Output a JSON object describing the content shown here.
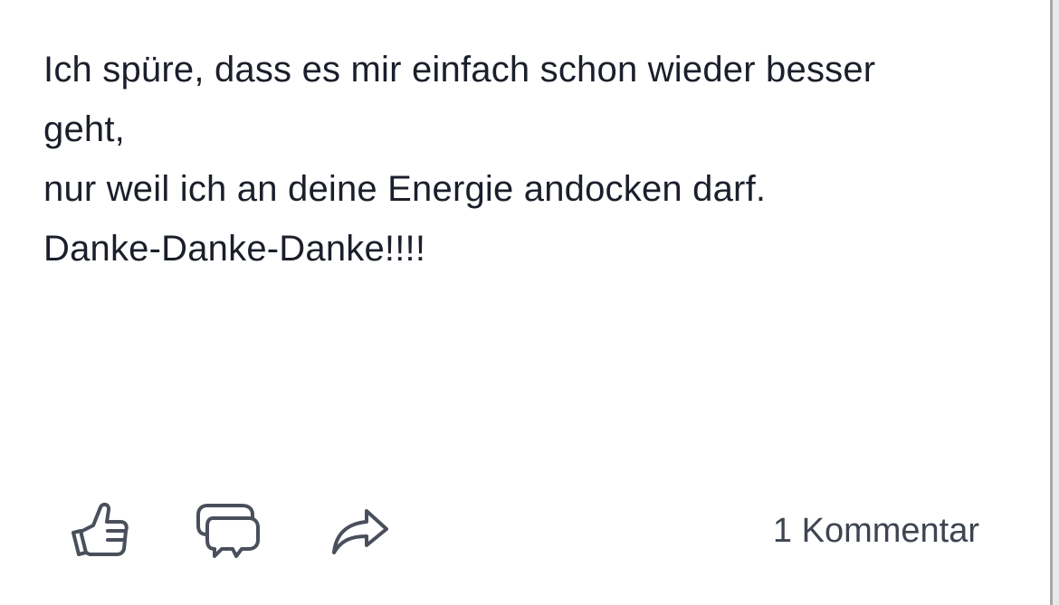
{
  "post": {
    "lines": [
      "Ich spüre, dass es mir einfach schon wieder besser",
      "geht,",
      "nur weil ich an deine Energie andocken darf.",
      "Danke-Danke-Danke!!!!"
    ]
  },
  "actions": {
    "like_icon": "thumbs-up-icon",
    "comment_icon": "speech-bubbles-icon",
    "share_icon": "share-arrow-icon",
    "comment_count_label": "1 Kommentar"
  },
  "colors": {
    "text": "#1b1f2b",
    "icon_stroke": "#4a4f5c",
    "meta_text": "#3f4452",
    "background": "#ffffff"
  }
}
